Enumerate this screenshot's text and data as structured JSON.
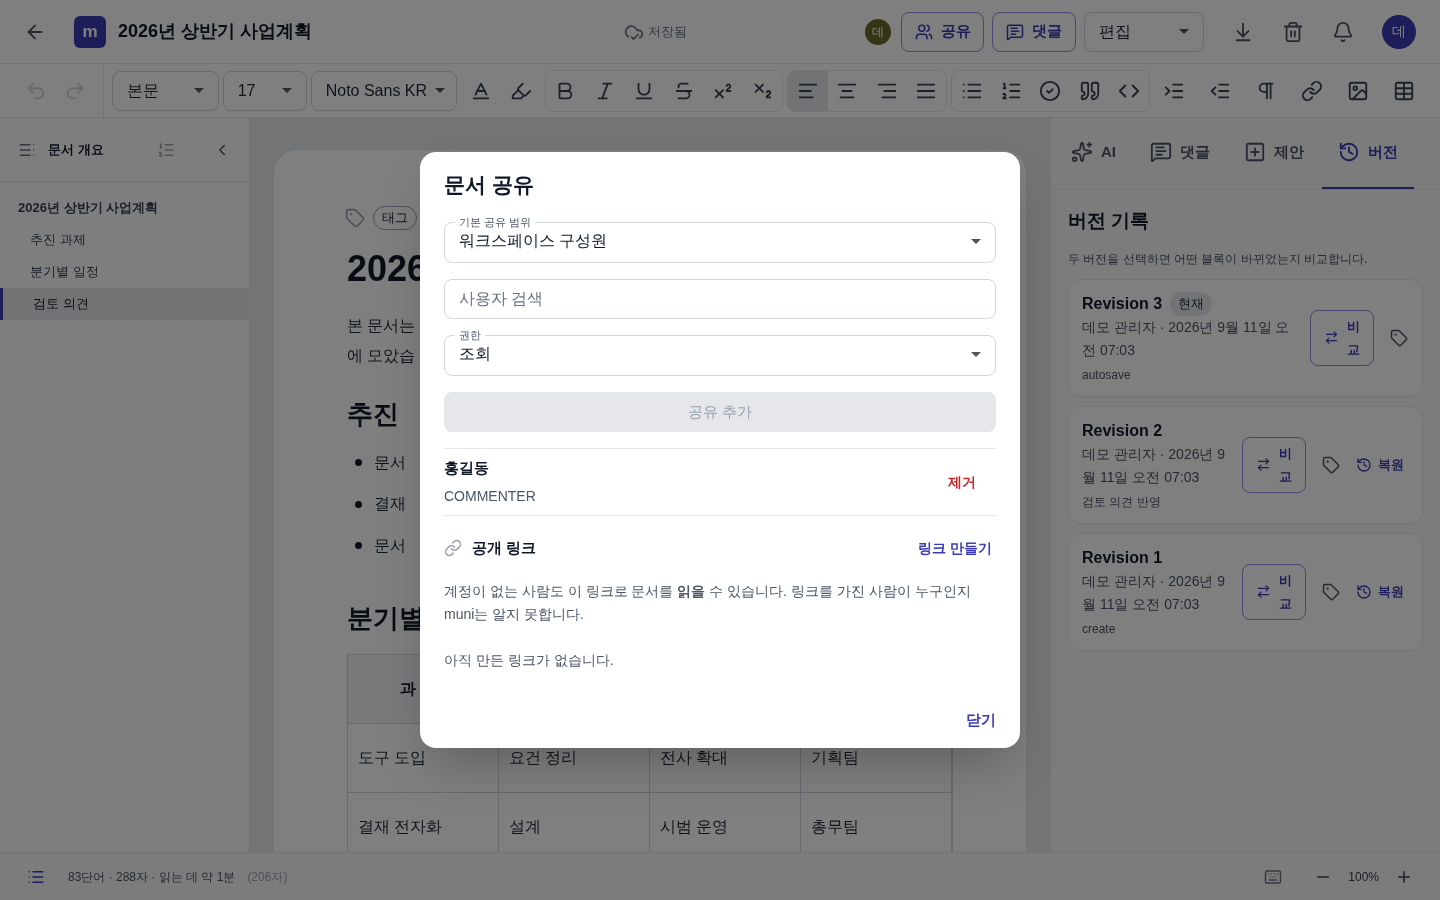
{
  "header": {
    "logo": "m",
    "title": "2026년 상반기 사업계획",
    "save_status": "저장됨",
    "collaborator_avatar": "데",
    "share_button": "공유",
    "comment_button": "댓글",
    "mode_select": "편집",
    "user_avatar": "데"
  },
  "toolbar": {
    "history_buttons": [
      {
        "disabled": true
      },
      {
        "disabled": true
      }
    ],
    "style_select": "본문",
    "size_select": "17",
    "font_select": "Noto Sans KR",
    "align_buttons": [
      {
        "selected": true
      },
      {
        "selected": false
      },
      {
        "selected": false
      },
      {
        "selected": false
      }
    ]
  },
  "sidebar": {
    "title": "문서 개요",
    "outline": [
      {
        "label": "2026년 상반기 사업계획",
        "selected": false,
        "children": [
          {
            "label": "추진 과제",
            "selected": false
          },
          {
            "label": "분기별 일정",
            "selected": false
          },
          {
            "label": "검토 의견",
            "selected": true
          }
        ]
      }
    ]
  },
  "document": {
    "tag_chip": "태그",
    "title": "2026",
    "paragraph_lines": [
      "본 문서는",
      "에 모았습"
    ],
    "heading_1": "추진",
    "bullets": [
      "문서",
      "결재",
      "문서"
    ],
    "heading_2": "분기별",
    "table": {
      "header": [
        "과"
      ],
      "rows": [
        [
          "도구 도입",
          "요건 정리",
          "전사 확대",
          "기획팀"
        ],
        [
          "결재 전자화",
          "설계",
          "시범 운영",
          "총무팀"
        ]
      ]
    }
  },
  "right_panel": {
    "tabs": [
      {
        "label": "AI",
        "selected": false
      },
      {
        "label": "댓글",
        "selected": false
      },
      {
        "label": "제안",
        "selected": false
      },
      {
        "label": "버전",
        "selected": true
      }
    ],
    "title": "버전 기록",
    "description": "두 버전을 선택하면 어떤 블록이 바뀌었는지 비교합니다.",
    "revisions": [
      {
        "name": "Revision 3",
        "badge": "현재",
        "meta": "데모 관리자 · 2026년 9월 11일 오전 07:03",
        "note": "autosave",
        "compare": "비교"
      },
      {
        "name": "Revision 2",
        "meta": "데모 관리자 · 2026년 9월 11일 오전 07:03",
        "note": "검토 의견 반영",
        "compare": "비교",
        "restore": "복원"
      },
      {
        "name": "Revision 1",
        "meta": "데모 관리자 · 2026년 9월 11일 오전 07:03",
        "note": "create",
        "compare": "비교",
        "restore": "복원"
      }
    ]
  },
  "status_bar": {
    "counts": "83단어 · 288자 · 읽는 데 약 1분",
    "characters": "(206자)",
    "zoom": "100%"
  },
  "share_dialog": {
    "title": "문서 공유",
    "scope_select": {
      "label": "기본 공유 범위",
      "value": "워크스페이스 구성원"
    },
    "user_search": {
      "placeholder": "사용자 검색"
    },
    "permission_select": {
      "label": "권한",
      "value": "조회"
    },
    "add_button": {
      "label": "공유 추가",
      "disabled": true
    },
    "members": [
      {
        "name": "홍길동",
        "role": "COMMENTER",
        "remove": "제거"
      }
    ],
    "public_link": {
      "title": "공개 링크",
      "create": "링크 만들기",
      "description": "계정이 없는 사람도 이 링크로 문서를 **읽을** 수 있습니다. 링크를 가진 사람이 누구인지 muni는 알지 못합니다.",
      "empty": "아직 만든 링크가 없습니다."
    },
    "close_button": "닫기"
  }
}
